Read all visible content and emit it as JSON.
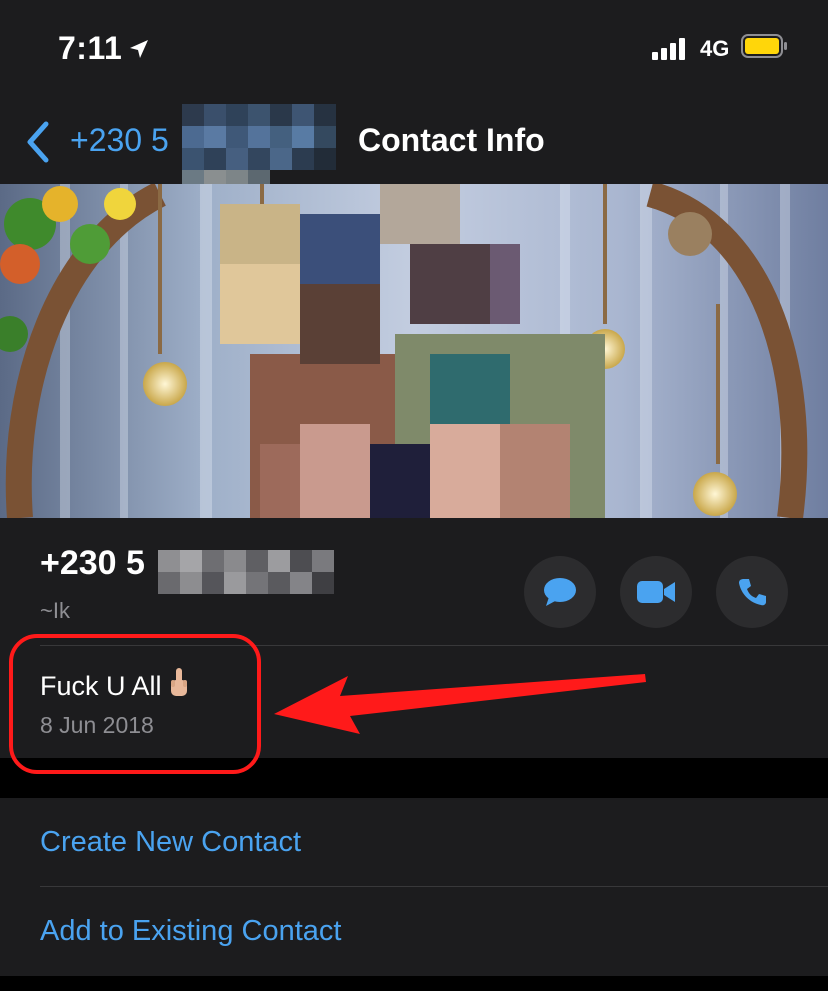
{
  "status_bar": {
    "time": "7:11",
    "network": "4G"
  },
  "nav": {
    "back_label": "+230 5",
    "title": "Contact Info"
  },
  "contact": {
    "phone_prefix": "+230 5",
    "username": "~Ik"
  },
  "about": {
    "text": "Fuck U All",
    "date": "8 Jun 2018"
  },
  "actions": [
    {
      "label": "Create New Contact"
    },
    {
      "label": "Add to Existing Contact"
    }
  ],
  "colors": {
    "accent": "#4aa3f0",
    "highlight": "#ff1a1a",
    "background": "#1c1c1e",
    "battery": "#ffd60a"
  },
  "icons": [
    "location-arrow-icon",
    "signal-icon",
    "battery-icon",
    "back-chevron-icon",
    "message-icon",
    "video-icon",
    "phone-icon",
    "middle-finger-emoji-icon",
    "red-arrow-annotation"
  ]
}
